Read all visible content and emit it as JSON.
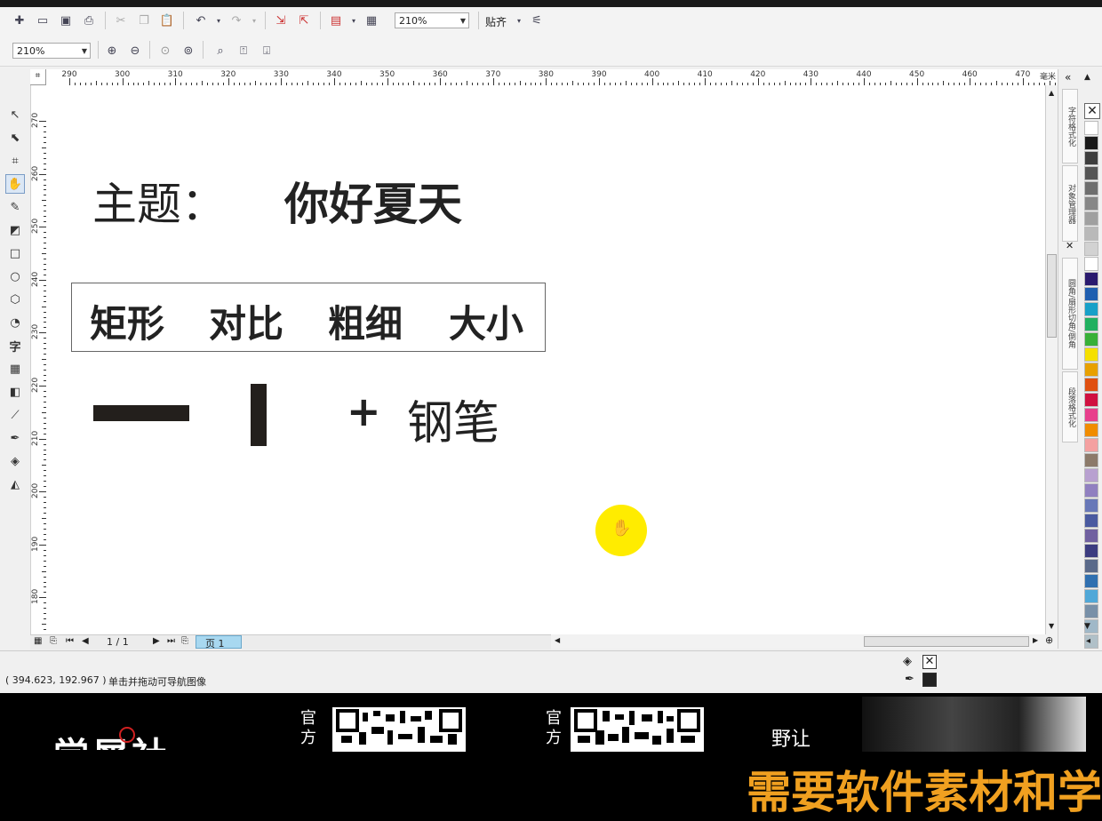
{
  "toolbar1": {
    "zoom": "210%",
    "snap_label": "贴齐"
  },
  "toolbar2": {
    "zoom": "210%"
  },
  "ruler": {
    "h_labels": [
      "290",
      "300",
      "310",
      "320",
      "330",
      "340",
      "350",
      "360",
      "370",
      "380",
      "390",
      "400",
      "410",
      "420",
      "430",
      "440",
      "450",
      "460",
      "470"
    ],
    "h_unit": "毫米",
    "v_labels": [
      "270",
      "260",
      "250",
      "240",
      "230",
      "220",
      "210",
      "200",
      "190",
      "180"
    ]
  },
  "canvas": {
    "theme_label": "主题：",
    "theme_value": "你好夏天",
    "box_words": [
      "矩形",
      "对比",
      "粗细",
      "大小"
    ],
    "plus": "+",
    "pen": "钢笔"
  },
  "pagebar": {
    "count": "1 / 1",
    "tab": "页 1"
  },
  "dockers": [
    "字符格式化",
    "对象管理器",
    "圆角/扇形切角/倒角",
    "段落格式化"
  ],
  "palette": [
    "#ffffff",
    "#1a1a1a",
    "#3d3d3d",
    "#555555",
    "#6e6e6e",
    "#878787",
    "#a0a0a0",
    "#b9b9b9",
    "#d2d2d2",
    "#ffffff",
    "#2a1a6e",
    "#1f5fb0",
    "#18a0c8",
    "#20b060",
    "#38b038",
    "#f5e000",
    "#e8a000",
    "#e05010",
    "#d01040",
    "#e83e8c",
    "#f08c00",
    "#f4a0a0",
    "#8c7a6a",
    "#b8a0d0",
    "#9080c0",
    "#6878b8",
    "#4a5aa0",
    "#7060a0",
    "#3c3c80",
    "#5a6a8a",
    "#3070b0",
    "#50a8d8",
    "#7890a8",
    "#a0b8c8",
    "#b0c0c8"
  ],
  "status": {
    "coords": "( 394.623, 192.967 )",
    "hint": "单击并拖动可导航图像",
    "fill_color": "#ffffff",
    "outline_color": "#222222"
  },
  "banner": {
    "brand": "学犀社",
    "official_1": "官方",
    "official_2": "官方",
    "side_text": "野让设",
    "slogan": "需要软件素材和学",
    "slogan_color": "#f0a020"
  }
}
